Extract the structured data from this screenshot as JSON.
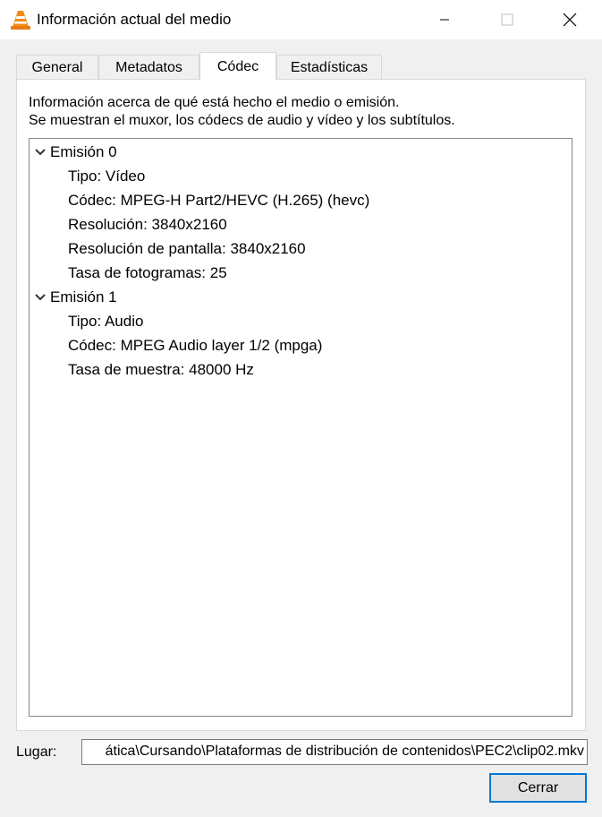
{
  "window": {
    "title": "Información actual del medio",
    "icon": "vlc-cone-icon"
  },
  "tabs": [
    {
      "label": "General",
      "active": false
    },
    {
      "label": "Metadatos",
      "active": false
    },
    {
      "label": "Códec",
      "active": true
    },
    {
      "label": "Estadísticas",
      "active": false
    }
  ],
  "codec": {
    "description_line1": "Información acerca de qué está hecho el medio o emisión.",
    "description_line2": "Se muestran el muxor, los códecs de audio y vídeo y los subtítulos.",
    "streams": [
      {
        "label": "Emisión 0",
        "expanded": true,
        "items": [
          "Tipo: Vídeo",
          "Códec: MPEG-H Part2/HEVC (H.265) (hevc)",
          "Resolución: 3840x2160",
          "Resolución de pantalla: 3840x2160",
          "Tasa de fotogramas: 25"
        ]
      },
      {
        "label": "Emisión 1",
        "expanded": true,
        "items": [
          "Tipo: Audio",
          "Códec: MPEG Audio layer 1/2 (mpga)",
          "Tasa de muestra: 48000 Hz"
        ]
      }
    ]
  },
  "footer": {
    "location_label": "Lugar:",
    "location_value": "ática\\Cursando\\Plataformas de distribución de contenidos\\PEC2\\clip02.mkv",
    "close_label": "Cerrar"
  },
  "colors": {
    "accent": "#0078d7",
    "vlc_orange": "#f28c18"
  }
}
